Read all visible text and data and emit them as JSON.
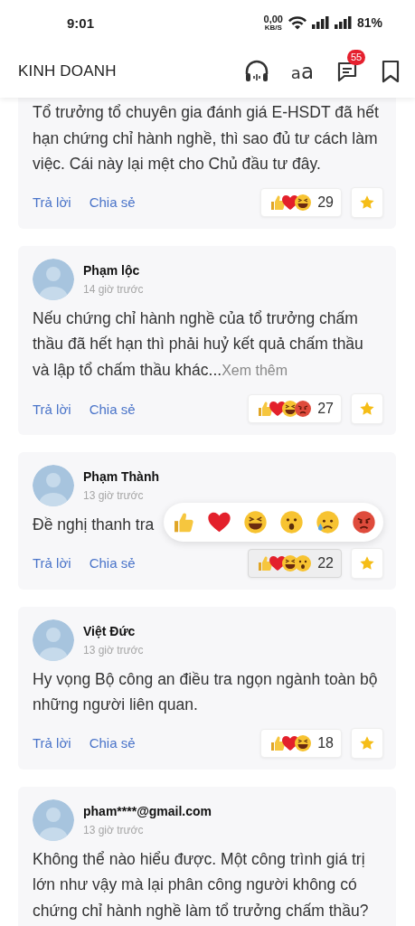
{
  "status_bar": {
    "time": "9:01",
    "net_speed": "0,00",
    "net_unit": "KB/S",
    "battery": "81%"
  },
  "header": {
    "title": "KINH DOANH",
    "font_button": "aa",
    "comments_badge": "55"
  },
  "comments": [
    {
      "text": "Tổ trưởng tổ chuyên gia đánh giá E-HSDT đã hết hạn chứng chỉ hành nghề, thì sao đủ tư cách làm việc. Cái này lại mệt cho Chủ đầu tư đây.",
      "reply": "Trả lời",
      "share": "Chia sẻ",
      "reactions": [
        {
          "kind": "like"
        },
        {
          "kind": "love"
        },
        {
          "kind": "haha"
        }
      ],
      "reaction_count": "29",
      "pressed": false
    },
    {
      "author": "Phạm lộc",
      "time": "14 giờ trước",
      "text": "Nếu chứng chỉ hành nghề của tổ trưởng chấm thầu đã hết hạn thì phải huỷ kết quả chấm thầu và lập tổ chấm thầu khác...",
      "more": "Xem thêm",
      "reply": "Trả lời",
      "share": "Chia sẻ",
      "reactions": [
        {
          "kind": "like"
        },
        {
          "kind": "love"
        },
        {
          "kind": "haha"
        },
        {
          "kind": "angry"
        }
      ],
      "reaction_count": "27",
      "pressed": false
    },
    {
      "author": "Phạm Thành",
      "time": "13 giờ trước",
      "text": "Đề nghị thanh tra",
      "reply": "Trả lời",
      "share": "Chia sẻ",
      "reactions": [
        {
          "kind": "like"
        },
        {
          "kind": "love"
        },
        {
          "kind": "haha"
        },
        {
          "kind": "wow"
        }
      ],
      "reaction_count": "22",
      "pressed": true,
      "picker": [
        {
          "kind": "like"
        },
        {
          "kind": "love"
        },
        {
          "kind": "haha"
        },
        {
          "kind": "wow"
        },
        {
          "kind": "sad"
        },
        {
          "kind": "angry"
        }
      ]
    },
    {
      "author": "Việt Đức",
      "time": "13 giờ trước",
      "text": "Hy vọng Bộ công an điều tra ngọn ngành toàn bộ những người liên quan.",
      "reply": "Trả lời",
      "share": "Chia sẻ",
      "reactions": [
        {
          "kind": "like"
        },
        {
          "kind": "love"
        },
        {
          "kind": "haha"
        }
      ],
      "reaction_count": "18",
      "pressed": false
    },
    {
      "author": "pham****@gmail.com",
      "time": "13 giờ trước",
      "text": "Không thể nào hiểu được. Một công trình giá trị lớn như vậy mà lại phân công người không có chứng chỉ hành nghề làm tổ trưởng chấm thầu?"
    }
  ]
}
